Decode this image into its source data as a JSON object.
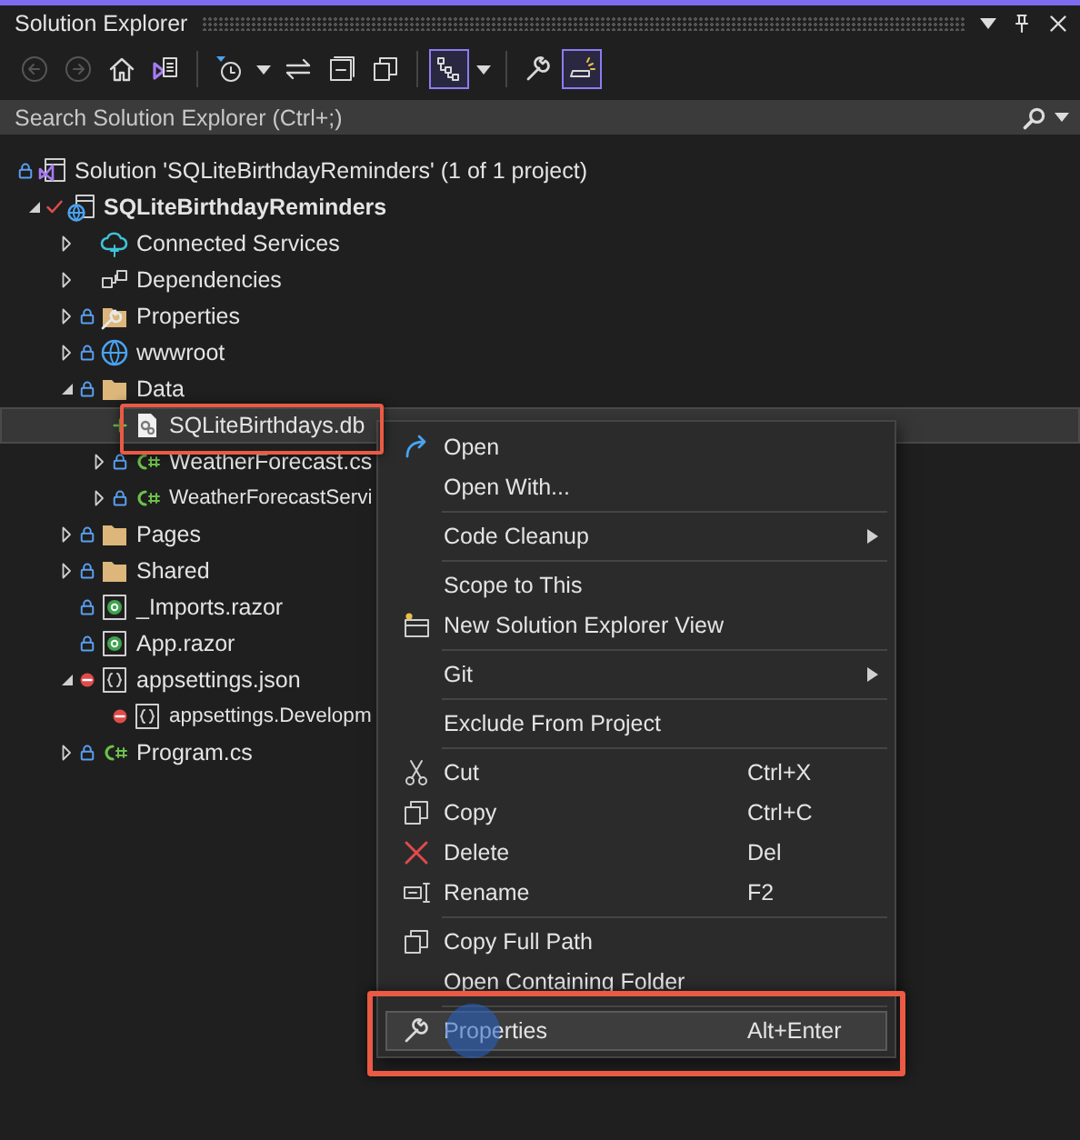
{
  "window": {
    "title": "Solution Explorer"
  },
  "toolbar": [
    {
      "kind": "back",
      "disabled": true,
      "on": false
    },
    {
      "kind": "forward",
      "disabled": true,
      "on": false
    },
    {
      "kind": "home",
      "disabled": false,
      "on": false
    },
    {
      "kind": "switch-views",
      "disabled": false,
      "on": false
    },
    {
      "kind": "separator"
    },
    {
      "kind": "pending-changes",
      "disabled": false,
      "on": false
    },
    {
      "kind": "dropdown",
      "disabled": false,
      "on": false
    },
    {
      "kind": "sync",
      "disabled": false,
      "on": false
    },
    {
      "kind": "collapse-all",
      "disabled": false,
      "on": false
    },
    {
      "kind": "show-all-files",
      "disabled": false,
      "on": false
    },
    {
      "kind": "separator"
    },
    {
      "kind": "tree-view",
      "disabled": false,
      "on": true
    },
    {
      "kind": "dropdown",
      "disabled": false,
      "on": false
    },
    {
      "kind": "separator"
    },
    {
      "kind": "properties",
      "disabled": false,
      "on": false
    },
    {
      "kind": "preview",
      "disabled": false,
      "on": true
    }
  ],
  "search": {
    "placeholder": "Search Solution Explorer (Ctrl+;)"
  },
  "tree": [
    {
      "label": "Solution 'SQLiteBirthdayReminders' (1 of 1 project)",
      "kind": "solution",
      "locked": true,
      "selected": false,
      "children": [
        {
          "label": "SQLiteBirthdayReminders",
          "kind": "project",
          "locked": false,
          "modified": true,
          "expanded": true,
          "bold": true,
          "selected": false,
          "children": [
            {
              "label": "Connected Services",
              "kind": "cloud",
              "locked": false,
              "expanded": false,
              "selected": false
            },
            {
              "label": "Dependencies",
              "kind": "dependencies",
              "locked": false,
              "expanded": false,
              "selected": false
            },
            {
              "label": "Properties",
              "kind": "properties-folder",
              "locked": true,
              "expanded": false,
              "selected": false
            },
            {
              "label": "wwwroot",
              "kind": "globe",
              "locked": true,
              "expanded": false,
              "selected": false
            },
            {
              "label": "Data",
              "kind": "folder",
              "locked": true,
              "expanded": true,
              "selected": false,
              "children": [
                {
                  "label": "SQLiteBirthdays.db",
                  "kind": "database-file",
                  "locked": false,
                  "added": true,
                  "selected": true,
                  "callout": true
                },
                {
                  "label": "WeatherForecast.cs",
                  "kind": "csharp",
                  "locked": true,
                  "expanded": false,
                  "selected": false
                },
                {
                  "label": "WeatherForecastServi",
                  "kind": "csharp",
                  "locked": true,
                  "expanded": false,
                  "selected": false
                }
              ]
            },
            {
              "label": "Pages",
              "kind": "folder",
              "locked": true,
              "expanded": false,
              "selected": false
            },
            {
              "label": "Shared",
              "kind": "folder",
              "locked": true,
              "expanded": false,
              "selected": false
            },
            {
              "label": "_Imports.razor",
              "kind": "razor",
              "locked": true,
              "selected": false
            },
            {
              "label": "App.razor",
              "kind": "razor",
              "locked": true,
              "selected": false
            },
            {
              "label": "appsettings.json",
              "kind": "json",
              "locked": false,
              "excluded": true,
              "expanded": true,
              "selected": false,
              "children": [
                {
                  "label": "appsettings.Developm",
                  "kind": "json",
                  "locked": false,
                  "excluded": true,
                  "selected": false
                }
              ]
            },
            {
              "label": "Program.cs",
              "kind": "csharp",
              "locked": true,
              "expanded": false,
              "selected": false
            }
          ]
        }
      ]
    }
  ],
  "context_menu": {
    "groups": [
      [
        {
          "label": "Open",
          "kind": "open",
          "submenu": false,
          "highlighted": false
        },
        {
          "label": "Open With...",
          "kind": "plain",
          "submenu": false,
          "highlighted": false
        }
      ],
      [
        {
          "label": "Code Cleanup",
          "kind": "plain",
          "submenu": true,
          "highlighted": false
        }
      ],
      [
        {
          "label": "Scope to This",
          "kind": "plain",
          "submenu": false,
          "highlighted": false
        },
        {
          "label": "New Solution Explorer View",
          "kind": "new-view",
          "submenu": false,
          "highlighted": false
        }
      ],
      [
        {
          "label": "Git",
          "kind": "plain",
          "submenu": true,
          "highlighted": false
        }
      ],
      [
        {
          "label": "Exclude From Project",
          "kind": "plain",
          "submenu": false,
          "highlighted": false
        }
      ],
      [
        {
          "label": "Cut",
          "shortcut": "Ctrl+X",
          "kind": "cut",
          "submenu": false,
          "highlighted": false
        },
        {
          "label": "Copy",
          "shortcut": "Ctrl+C",
          "kind": "copy",
          "submenu": false,
          "highlighted": false
        },
        {
          "label": "Delete",
          "shortcut": "Del",
          "kind": "delete",
          "submenu": false,
          "highlighted": false
        },
        {
          "label": "Rename",
          "shortcut": "F2",
          "kind": "rename",
          "submenu": false,
          "highlighted": false
        }
      ],
      [
        {
          "label": "Copy Full Path",
          "kind": "copy",
          "submenu": false,
          "highlighted": false
        },
        {
          "label": "Open Containing Folder",
          "kind": "plain",
          "submenu": false,
          "highlighted": false
        }
      ],
      [
        {
          "label": "Properties",
          "shortcut": "Alt+Enter",
          "kind": "wrench",
          "submenu": false,
          "highlighted": true,
          "clicked": true,
          "callout": true
        }
      ]
    ]
  }
}
